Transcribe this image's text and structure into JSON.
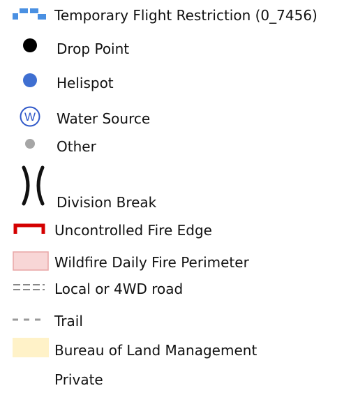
{
  "legend": {
    "items": [
      {
        "symbol": "tfr-dashed-boundary-icon",
        "label": "Temporary Flight Restriction (0_7456)",
        "color": "#4a90e2"
      },
      {
        "symbol": "drop-point-icon",
        "label": "Drop Point",
        "color": "#000000"
      },
      {
        "symbol": "helispot-icon",
        "label": "Helispot",
        "color": "#3f6fd1"
      },
      {
        "symbol": "water-source-icon",
        "label": "Water Source",
        "color": "#2f58c9"
      },
      {
        "symbol": "other-point-icon",
        "label": "Other",
        "color": "#a6a6a6"
      },
      {
        "symbol": "division-break-icon",
        "label": "Division Break",
        "color": "#111111"
      },
      {
        "symbol": "uncontrolled-fire-edge-icon",
        "label": "Uncontrolled Fire Edge",
        "color": "#d40000"
      },
      {
        "symbol": "wildfire-perimeter-icon",
        "label": "Wildfire Daily Fire Perimeter",
        "color": "#f8d6d6"
      },
      {
        "symbol": "local-road-icon",
        "label": "Local or 4WD road",
        "color": "#888888"
      },
      {
        "symbol": "trail-icon",
        "label": "Trail",
        "color": "#9a9a9a"
      },
      {
        "symbol": "blm-land-icon",
        "label": "Bureau of Land Management",
        "color": "#fff2c8"
      },
      {
        "symbol": "private-land-icon",
        "label": "Private",
        "color": "#ffffff"
      }
    ]
  },
  "glyphs": {
    "water_source": "W"
  }
}
